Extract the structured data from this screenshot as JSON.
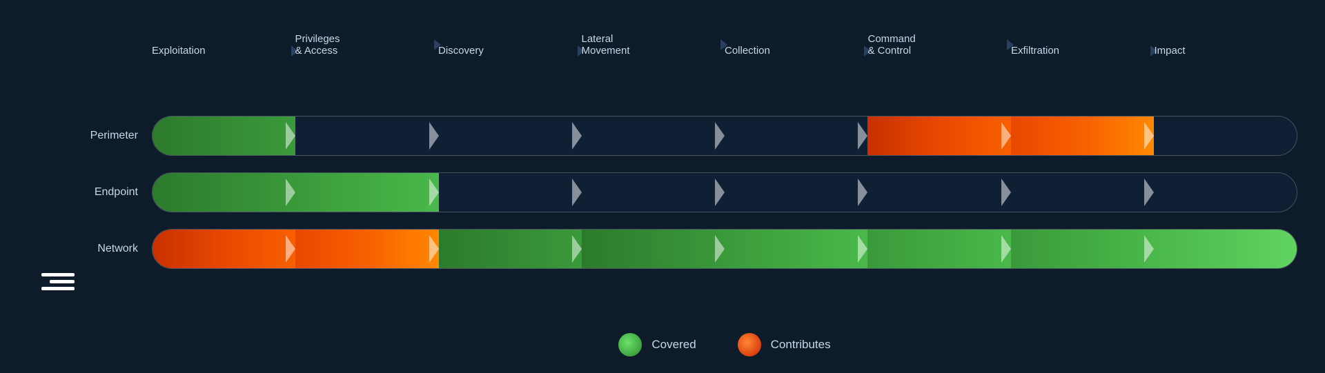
{
  "logo": {
    "lines": [
      48,
      36,
      48
    ]
  },
  "header": {
    "columns": [
      {
        "id": "exploitation",
        "label": "Exploitation"
      },
      {
        "id": "privileges",
        "label": "Privileges\n& Access"
      },
      {
        "id": "discovery",
        "label": "Discovery"
      },
      {
        "id": "lateral",
        "label": "Lateral\nMovement"
      },
      {
        "id": "collection",
        "label": "Collection"
      },
      {
        "id": "command",
        "label": "Command\n& Control"
      },
      {
        "id": "exfiltration",
        "label": "Exfiltration"
      },
      {
        "id": "impact",
        "label": "Impact"
      }
    ]
  },
  "rows": [
    {
      "id": "perimeter",
      "label": "Perimeter",
      "segments": [
        {
          "fill": "green"
        },
        {
          "fill": "empty"
        },
        {
          "fill": "empty"
        },
        {
          "fill": "empty"
        },
        {
          "fill": "empty"
        },
        {
          "fill": "red-orange"
        },
        {
          "fill": "orange"
        },
        {
          "fill": "empty"
        }
      ]
    },
    {
      "id": "endpoint",
      "label": "Endpoint",
      "segments": [
        {
          "fill": "green"
        },
        {
          "fill": "green"
        },
        {
          "fill": "empty"
        },
        {
          "fill": "empty"
        },
        {
          "fill": "empty"
        },
        {
          "fill": "empty"
        },
        {
          "fill": "empty"
        },
        {
          "fill": "empty"
        }
      ]
    },
    {
      "id": "network",
      "label": "Network",
      "segments": [
        {
          "fill": "red-orange"
        },
        {
          "fill": "orange-red"
        },
        {
          "fill": "green"
        },
        {
          "fill": "green"
        },
        {
          "fill": "green"
        },
        {
          "fill": "green"
        },
        {
          "fill": "green"
        },
        {
          "fill": "green-light"
        }
      ]
    }
  ],
  "legend": {
    "items": [
      {
        "id": "covered",
        "color": "green",
        "label": "Covered"
      },
      {
        "id": "contributes",
        "color": "orange",
        "label": "Contributes"
      }
    ]
  }
}
